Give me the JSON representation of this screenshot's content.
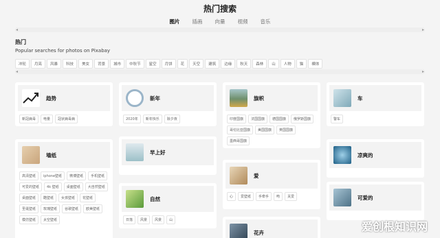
{
  "title": "热门搜索",
  "tabs": [
    "图片",
    "插画",
    "向量",
    "视频",
    "音乐"
  ],
  "section": {
    "title": "热门",
    "subtitle": "Popular searches for photos on Pixabay"
  },
  "hot_tags": [
    "冲轮",
    "月亮",
    "风暴",
    "科技",
    "美女",
    "背景",
    "城市",
    "中秋节",
    "星空",
    "月饼",
    "花",
    "天空",
    "建筑",
    "边缘",
    "秋天",
    "森林",
    "山",
    "人物",
    "猫",
    "裸体"
  ],
  "cards": [
    {
      "label": "趋势",
      "icon": "trend-chart-icon",
      "chips": [
        "新冠病毒",
        "电量",
        "冠状病毒病"
      ]
    },
    {
      "label": "新年",
      "icon": "wreath-thumbnail",
      "chips": [
        "2020年",
        "新年快乐",
        "除夕夜"
      ]
    },
    {
      "label": "旗帜",
      "icon": "flag-field-thumbnail",
      "chips": [
        "印度国旗",
        "法国国旗",
        "德国国旗",
        "俄罗斯国旗",
        "哥伦比亚国旗",
        "美国国旗",
        "英国国旗",
        "墨西哥国旗"
      ]
    },
    {
      "label": "车",
      "icon": "car-thumbnail",
      "chips": [
        "警车"
      ]
    },
    {
      "label": "墙纸",
      "icon": "wallpaper-thumbnail",
      "chips": [
        "高清壁纸",
        "iphone壁纸",
        "微博壁纸",
        "手机壁纸",
        "可爱的壁纸",
        "4k 壁纸",
        "桌面壁纸",
        "大自然壁纸",
        "桌面壁纸",
        "酷壁纸",
        "女孩壁纸",
        "花壁纸",
        "圣诞壁纸",
        "玫瑰壁纸",
        "谷歌壁纸",
        "欧美壁纸",
        "模仿壁纸",
        "太空壁纸"
      ]
    },
    {
      "label": "早上好",
      "icon": "morning-thumbnail",
      "chips": []
    },
    {
      "label": "凉爽的",
      "icon": "water-drop-thumbnail",
      "chips": []
    },
    {
      "label": "爱",
      "icon": "love-thumbnail",
      "chips": [
        "心",
        "爱壁纸",
        "手牵手",
        "吻",
        "关爱"
      ]
    },
    {
      "label": "自然",
      "icon": "nature-thumbnail",
      "chips": [
        "日落",
        "风景",
        "风景",
        "山"
      ]
    },
    {
      "label": "可爱的",
      "icon": "cute-thumbnail",
      "chips": []
    },
    {
      "label": "花卉",
      "icon": "flowers-thumbnail",
      "chips": []
    }
  ],
  "watermark": "爱创根知识网",
  "colors": {
    "accent": "#2ec66d",
    "background": "#f4f4f4",
    "card": "#ffffff",
    "card_head": "#f3f3f3"
  }
}
